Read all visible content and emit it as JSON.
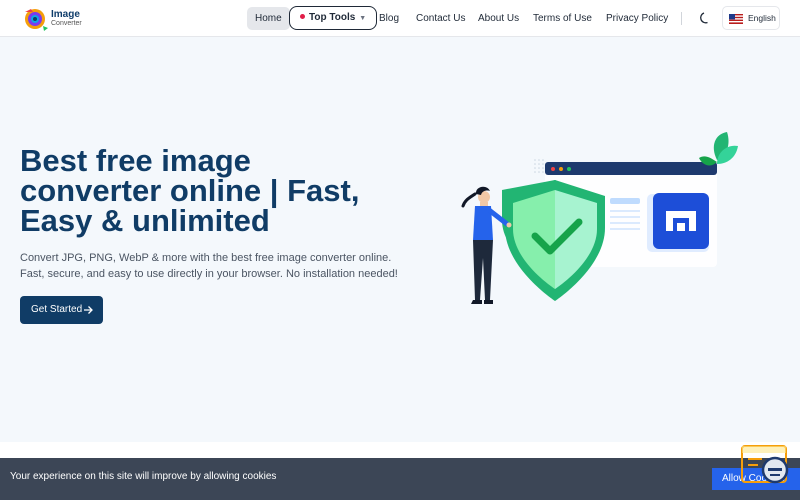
{
  "brand": {
    "logo_title": "Image",
    "logo_subtitle": "Converter"
  },
  "nav": {
    "items": [
      "Home",
      "Top Tools",
      "Blog",
      "Contact Us",
      "About Us",
      "Terms of Use",
      "Privacy Policy"
    ],
    "active": "Home",
    "theme_icon": "moon-icon",
    "language": "English",
    "language_flag": "us-flag-icon"
  },
  "hero": {
    "title": "Best free image converter online | Fast, Easy & unlimited",
    "description": "Convert JPG, PNG, WebP & more with the best free image converter online. Fast, secure, and easy to use directly in your browser. No installation needed!",
    "cta_label": "Get Started",
    "cta_icon": "arrow-right-icon"
  },
  "cookie": {
    "message": "Your experience on this site will improve by allowing cookies",
    "button_label": "Allow Cookies"
  },
  "colors": {
    "primary": "#103c66",
    "accent_blue": "#2563eb",
    "shield_green": "#22b573",
    "cookie_bg": "#3c4656"
  }
}
